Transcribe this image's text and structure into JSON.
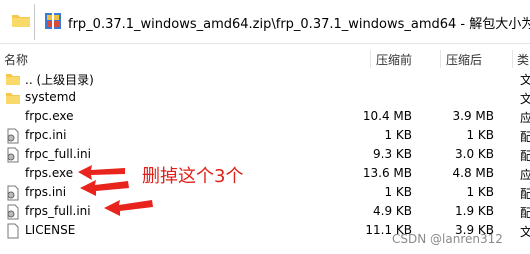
{
  "titlebar": {
    "path": "frp_0.37.1_windows_amd64.zip\\frp_0.37.1_windows_amd64 - 解包大小为"
  },
  "columns": {
    "name": "名称",
    "size": "压缩前",
    "packed": "压缩后",
    "type": "类"
  },
  "rows": [
    {
      "name": ".. (上级目录)",
      "size": "",
      "packed": "",
      "type": "文",
      "icon": "folder-icon"
    },
    {
      "name": "systemd",
      "size": "",
      "packed": "",
      "type": "文",
      "icon": "folder-icon"
    },
    {
      "name": "frpc.exe",
      "size": "10.4 MB",
      "packed": "3.9 MB",
      "type": "应",
      "icon": "exe-file-icon"
    },
    {
      "name": "frpc.ini",
      "size": "1 KB",
      "packed": "1 KB",
      "type": "配",
      "icon": "ini-file-icon"
    },
    {
      "name": "frpc_full.ini",
      "size": "9.3 KB",
      "packed": "3.0 KB",
      "type": "配",
      "icon": "ini-file-icon"
    },
    {
      "name": "frps.exe",
      "size": "13.6 MB",
      "packed": "4.8 MB",
      "type": "应",
      "icon": "exe-file-icon"
    },
    {
      "name": "frps.ini",
      "size": "1 KB",
      "packed": "1 KB",
      "type": "配",
      "icon": "ini-file-icon"
    },
    {
      "name": "frps_full.ini",
      "size": "4.9 KB",
      "packed": "1.9 KB",
      "type": "配",
      "icon": "ini-file-icon"
    },
    {
      "name": "LICENSE",
      "size": "11.1 KB",
      "packed": "3.9 KB",
      "type": "文",
      "icon": "file-icon"
    }
  ],
  "annotation": "删掉这个3个",
  "watermark": "CSDN @lanren312",
  "colors": {
    "annotation_red": "#e0201a",
    "folder_yellow": "#f5c84c"
  }
}
